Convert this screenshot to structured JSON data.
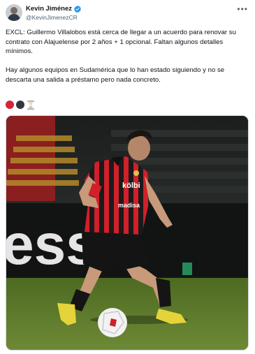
{
  "author": {
    "display_name": "Kevin Jiménez",
    "handle": "@KevinJimenezCR"
  },
  "tweet": {
    "paragraph_1": "EXCL: Guillermo Villalobos está cerca de llegar a un acuerdo para renovar su contrato con Alajuelense por 2 años + 1 opcional. Faltan algunos detalles mínimos.",
    "paragraph_2": "Hay algunos equipos en Sudamérica que lo han estado siguiendo y no se descarta una salida a préstamo pero nada concreto."
  },
  "emojis": [
    "red-circle",
    "black-circle",
    "hourglass"
  ],
  "media": {
    "board_text": "ess",
    "shirt_brand": "kölbi",
    "shirt_sponsor": "madisa"
  },
  "colors": {
    "verified": "#1d9bf0",
    "shirt_red": "#d0202a",
    "pitch_green": "#5f7a2c"
  }
}
